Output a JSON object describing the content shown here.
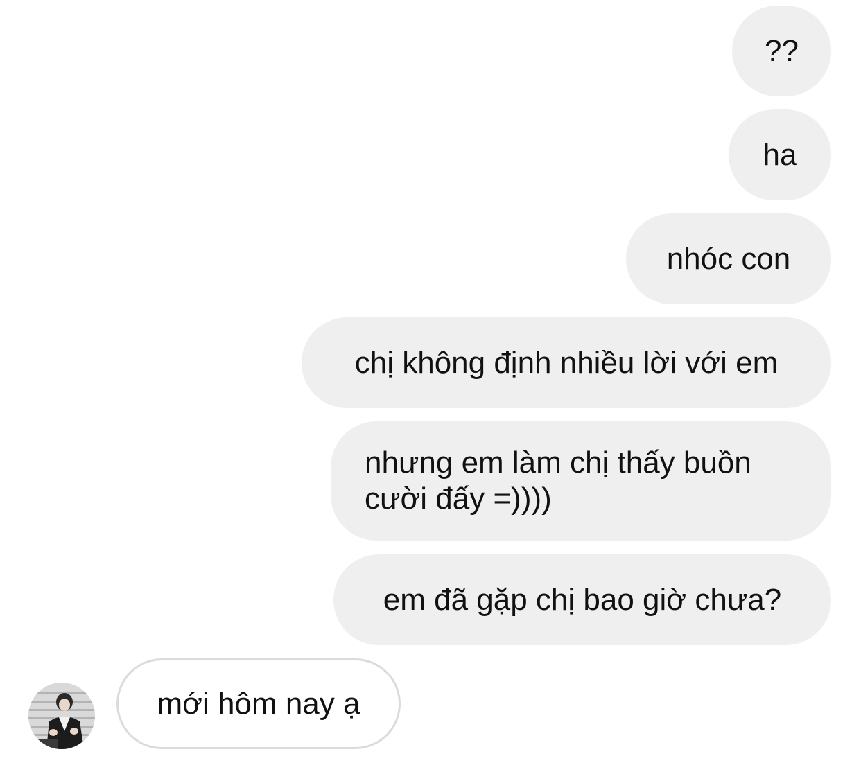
{
  "messages": [
    {
      "sender": "me",
      "text": "??"
    },
    {
      "sender": "me",
      "text": "ha"
    },
    {
      "sender": "me",
      "text": "nhóc con"
    },
    {
      "sender": "me",
      "text": "chị không định nhiều lời với em"
    },
    {
      "sender": "me",
      "text": "nhưng em làm chị thấy buồn cười đấy =))))"
    },
    {
      "sender": "me",
      "text": "em đã gặp chị bao giờ chưa?"
    },
    {
      "sender": "them",
      "text": "mới hôm nay ạ"
    }
  ],
  "contact": {
    "avatar_icon": "profile-photo-avatar"
  },
  "colors": {
    "sent_bubble": "#efefef",
    "received_border": "#dbdbdb",
    "text": "#111111",
    "background": "#ffffff"
  }
}
